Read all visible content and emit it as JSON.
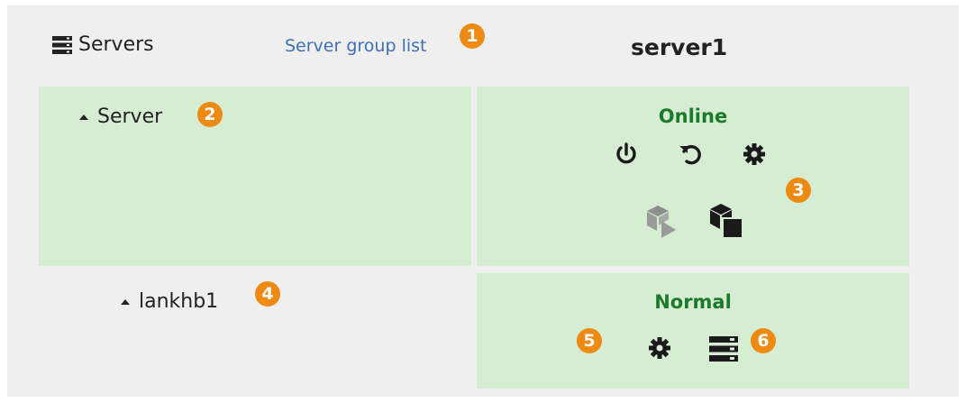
{
  "header": {
    "title": "Servers",
    "title_icon": "server-list-icon",
    "group_link": "Server group list",
    "server_name": "server1"
  },
  "server_row": {
    "label": "Server",
    "status": "Online",
    "status_color": "#1c7a2b",
    "actions": [
      {
        "name": "power-icon",
        "enabled": true
      },
      {
        "name": "restart-icon",
        "enabled": true
      },
      {
        "name": "settings-gear-icon",
        "enabled": true
      },
      {
        "name": "start-cluster-box-icon",
        "enabled": false
      },
      {
        "name": "stop-cluster-box-icon",
        "enabled": true
      }
    ]
  },
  "lan_row": {
    "label": "lankhb1",
    "status": "Normal",
    "actions": [
      {
        "name": "settings-gear-icon",
        "enabled": true
      },
      {
        "name": "server-list-icon",
        "enabled": true
      }
    ]
  },
  "badges": {
    "b1": "1",
    "b2": "2",
    "b3": "3",
    "b4": "4",
    "b5": "5",
    "b6": "6"
  },
  "colors": {
    "panel_bg": "#efefef",
    "row_bg": "#d6ecd3",
    "link": "#3f6fb4",
    "badge": "#ec8a12"
  }
}
